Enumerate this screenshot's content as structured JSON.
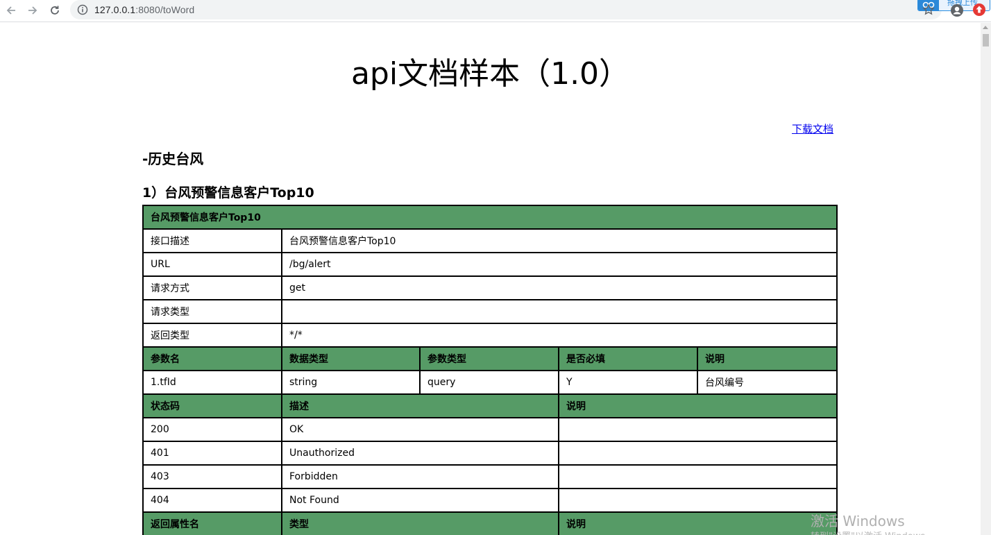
{
  "browser": {
    "url_host": "127.0.0.1",
    "url_path": ":8080/toWord",
    "extension_label": "拖拽上传"
  },
  "page": {
    "title": "api文档样本（1.0）",
    "download_link": "下载文档",
    "section_heading": "-历史台风",
    "api_heading": "1）台风预警信息客户Top10"
  },
  "api_table": {
    "caption": "台风预警信息客户Top10",
    "info": [
      {
        "label": "接口描述",
        "value": "台风预警信息客户Top10"
      },
      {
        "label": "URL",
        "value": "/bg/alert"
      },
      {
        "label": "请求方式",
        "value": "get"
      },
      {
        "label": "请求类型",
        "value": ""
      },
      {
        "label": "返回类型",
        "value": "*/*"
      }
    ],
    "param_headers": [
      "参数名",
      "数据类型",
      "参数类型",
      "是否必填",
      "说明"
    ],
    "params": [
      [
        "1.tfId",
        "string",
        "query",
        "Y",
        "台风编号"
      ]
    ],
    "status_headers": [
      "状态码",
      "描述",
      "说明"
    ],
    "statuses": [
      [
        "200",
        "OK",
        ""
      ],
      [
        "401",
        "Unauthorized",
        ""
      ],
      [
        "403",
        "Forbidden",
        ""
      ],
      [
        "404",
        "Not Found",
        ""
      ]
    ],
    "return_headers": [
      "返回属性名",
      "类型",
      "说明"
    ]
  },
  "watermark": {
    "line1": "激活 Windows",
    "line2": "转到\"设置\"以激活 Windows。"
  },
  "colors": {
    "header_bg": "#569b66",
    "link": "#0000ee"
  }
}
